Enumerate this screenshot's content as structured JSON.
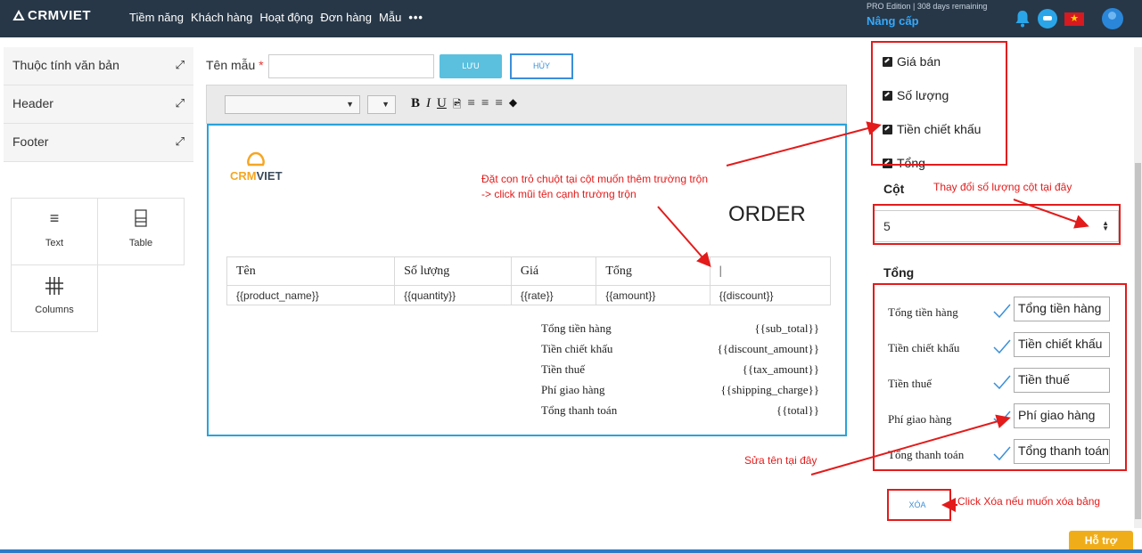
{
  "topbar": {
    "logo": "CRMVIET",
    "nav": [
      "Tiềm năng",
      "Khách hàng",
      "Hoạt động",
      "Đơn hàng",
      "Mẫu",
      "•••"
    ],
    "edition": "PRO Edition | 308 days remaining",
    "upgrade": "Nâng cấp"
  },
  "left": {
    "sections": [
      "Thuộc tính văn bản",
      "Header",
      "Footer"
    ],
    "tools": [
      "Text",
      "Table",
      "Columns"
    ]
  },
  "editor": {
    "name_label": "Tên mẫu",
    "required_mark": "*",
    "save": "LƯU",
    "cancel": "HỦY",
    "doc_logo": "CRMVIET",
    "doc_logo_a": "CRM",
    "doc_logo_b": "VIET",
    "order_title": "ORDER",
    "table_headers": [
      "Tên",
      "Số lượng",
      "Giá",
      "Tổng",
      "|"
    ],
    "table_row": [
      "{{product_name}}",
      "{{quantity}}",
      "{{rate}}",
      "{{amount}}",
      "{{discount}}"
    ],
    "totals": [
      {
        "label": "Tổng tiền hàng",
        "value": "{{sub_total}}"
      },
      {
        "label": "Tiền chiết khấu",
        "value": "{{discount_amount}}"
      },
      {
        "label": "Tiền thuế",
        "value": "{{tax_amount}}"
      },
      {
        "label": "Phí giao hàng",
        "value": "{{shipping_charge}}"
      },
      {
        "label": "Tổng thanh toán",
        "value": "{{total}}"
      }
    ]
  },
  "right": {
    "fields": [
      "Giá bán",
      "Số lượng",
      "Tiền chiết khấu",
      "Tổng"
    ],
    "columns_label": "Cột",
    "columns_value": "5",
    "totals_label": "Tổng",
    "total_rows": [
      {
        "label": "Tổng tiền hàng",
        "value": "Tổng tiền hàng"
      },
      {
        "label": "Tiền chiết khấu",
        "value": "Tiền chiết khấu"
      },
      {
        "label": "Tiền thuế",
        "value": "Tiền thuế"
      },
      {
        "label": "Phí giao hàng",
        "value": "Phí giao hàng"
      },
      {
        "label": "Tổng thanh toán",
        "value": "Tổng thanh toán"
      }
    ],
    "delete": "XÓA"
  },
  "annotations": {
    "cursor_note_1": "Đặt con trỏ chuột tại cột muốn thêm trường trộn",
    "cursor_note_2": "-> click mũi tên cạnh trường trộn",
    "columns_note": "Thay đổi số lượng cột tại đây",
    "rename_note": "Sửa tên tại đây",
    "delete_note": "Click Xóa nếu muốn xóa bảng"
  },
  "support": "Hỗ trợ",
  "colors": {
    "topbar": "#273747",
    "accent": "#29a3d9",
    "annotation": "#e31b1b",
    "support": "#f0ad1a"
  }
}
